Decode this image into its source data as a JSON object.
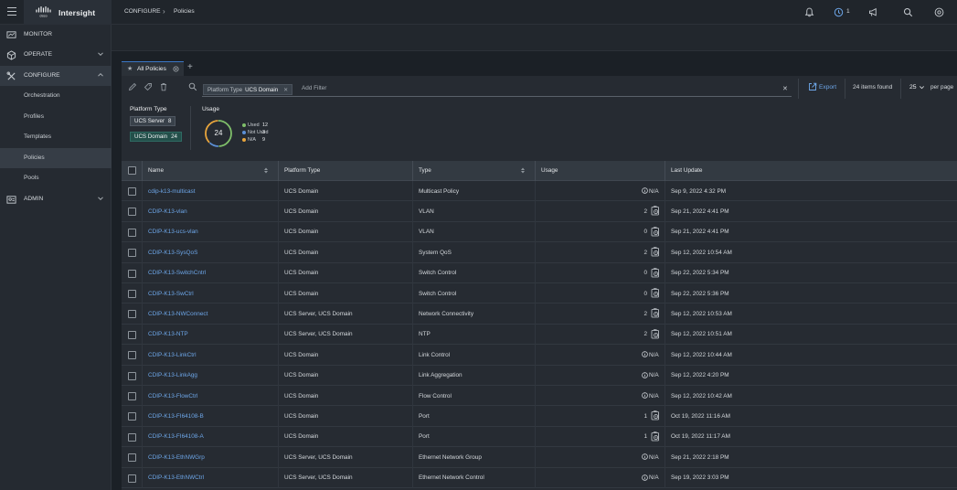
{
  "app": {
    "name": "Intersight"
  },
  "breadcrumb": {
    "section": "CONFIGURE",
    "page": "Policies"
  },
  "header": {
    "notification_count": "1"
  },
  "sidebar": {
    "items": [
      {
        "label": "MONITOR",
        "icon": "monitor-icon"
      },
      {
        "label": "OPERATE",
        "icon": "operate-icon"
      },
      {
        "label": "CONFIGURE",
        "icon": "configure-icon",
        "active": true
      },
      {
        "label": "ADMIN",
        "icon": "admin-icon"
      }
    ],
    "configure_subitems": [
      "Orchestration",
      "Profiles",
      "Templates",
      "Policies",
      "Pools"
    ]
  },
  "tabs": {
    "active_label": "All Policies"
  },
  "filter": {
    "chip_key": "Platform Type",
    "chip_value": "UCS Domain",
    "add_placeholder": "Add Filter"
  },
  "toolbar": {
    "export_label": "Export",
    "items_found": "24 items found",
    "per_page_value": "25",
    "per_page_label": "per page"
  },
  "facets": {
    "platform_title": "Platform Type",
    "platform_options": [
      {
        "label": "UCS Server",
        "count": "8"
      },
      {
        "label": "UCS Domain",
        "count": "24"
      }
    ],
    "usage_title": "Usage",
    "usage_total": "24",
    "usage_legend": [
      {
        "label": "Used",
        "value": "12",
        "color": "#7fbf6a"
      },
      {
        "label": "Not Used",
        "value": "3",
        "color": "#5b8fd6"
      },
      {
        "label": "N/A",
        "value": "9",
        "color": "#e8a53c"
      }
    ]
  },
  "table": {
    "columns": [
      "Name",
      "Platform Type",
      "Type",
      "Usage",
      "Last Update"
    ],
    "rows": [
      {
        "name": "cdip-k13-multicast",
        "platform": "UCS Domain",
        "type": "Multicast Policy",
        "usage": "N/A",
        "updated": "Sep 9, 2022 4:32 PM"
      },
      {
        "name": "CDIP-K13-vlan",
        "platform": "UCS Domain",
        "type": "VLAN",
        "usage": "2",
        "updated": "Sep 21, 2022 4:41 PM"
      },
      {
        "name": "CDIP-K13-ucs-vlan",
        "platform": "UCS Domain",
        "type": "VLAN",
        "usage": "0",
        "updated": "Sep 21, 2022 4:41 PM"
      },
      {
        "name": "CDIP-K13-SysQoS",
        "platform": "UCS Domain",
        "type": "System QoS",
        "usage": "2",
        "updated": "Sep 12, 2022 10:54 AM"
      },
      {
        "name": "CDIP-K13-SwitchCntrl",
        "platform": "UCS Domain",
        "type": "Switch Control",
        "usage": "0",
        "updated": "Sep 22, 2022 5:34 PM"
      },
      {
        "name": "CDIP-K13-SwCtrl",
        "platform": "UCS Domain",
        "type": "Switch Control",
        "usage": "0",
        "updated": "Sep 22, 2022 5:36 PM"
      },
      {
        "name": "CDIP-K13-NWConnect",
        "platform": "UCS Server, UCS Domain",
        "type": "Network Connectivity",
        "usage": "2",
        "updated": "Sep 12, 2022 10:53 AM"
      },
      {
        "name": "CDIP-K13-NTP",
        "platform": "UCS Server, UCS Domain",
        "type": "NTP",
        "usage": "2",
        "updated": "Sep 12, 2022 10:51 AM"
      },
      {
        "name": "CDIP-K13-LinkCtrl",
        "platform": "UCS Domain",
        "type": "Link Control",
        "usage": "N/A",
        "updated": "Sep 12, 2022 10:44 AM"
      },
      {
        "name": "CDIP-K13-LinkAgg",
        "platform": "UCS Domain",
        "type": "Link Aggregation",
        "usage": "N/A",
        "updated": "Sep 12, 2022 4:20 PM"
      },
      {
        "name": "CDIP-K13-FlowCtrl",
        "platform": "UCS Domain",
        "type": "Flow Control",
        "usage": "N/A",
        "updated": "Sep 12, 2022 10:42 AM"
      },
      {
        "name": "CDIP-K13-FI64108-B",
        "platform": "UCS Domain",
        "type": "Port",
        "usage": "1",
        "updated": "Oct 19, 2022 11:16 AM"
      },
      {
        "name": "CDIP-K13-FI64108-A",
        "platform": "UCS Domain",
        "type": "Port",
        "usage": "1",
        "updated": "Oct 19, 2022 11:17 AM"
      },
      {
        "name": "CDIP-K13-EthNWGrp",
        "platform": "UCS Server, UCS Domain",
        "type": "Ethernet Network Group",
        "usage": "N/A",
        "updated": "Sep 21, 2022 2:18 PM"
      },
      {
        "name": "CDIP-K13-EthNWCtrl",
        "platform": "UCS Server, UCS Domain",
        "type": "Ethernet Network Control",
        "usage": "N/A",
        "updated": "Sep 19, 2022 3:03 PM"
      }
    ]
  }
}
